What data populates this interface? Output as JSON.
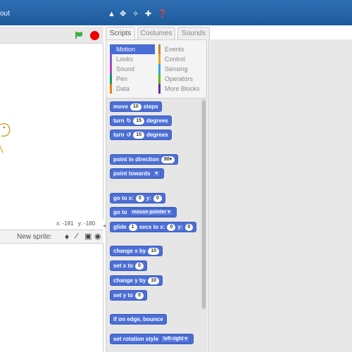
{
  "app": {
    "title_fragment": "out"
  },
  "toolbar": {
    "tools": [
      "stamp-icon",
      "grow-icon",
      "shrink-icon",
      "fullscreen-icon",
      "help-icon"
    ]
  },
  "stage": {
    "coords_x_label": "x:",
    "coords_x": "-181",
    "coords_y_label": "y:",
    "coords_y": "-180",
    "new_sprite_label": "New sprite:"
  },
  "tabs": {
    "scripts": "Scripts",
    "costumes": "Costumes",
    "sounds": "Sounds"
  },
  "categories": {
    "left": [
      {
        "label": "Motion",
        "color": "#4a6cd4"
      },
      {
        "label": "Looks",
        "color": "#8a55d7"
      },
      {
        "label": "Sound",
        "color": "#bb42c3"
      },
      {
        "label": "Pen",
        "color": "#0e9a6c"
      },
      {
        "label": "Data",
        "color": "#ee7d16"
      }
    ],
    "right": [
      {
        "label": "Events",
        "color": "#c88330"
      },
      {
        "label": "Control",
        "color": "#e1a91a"
      },
      {
        "label": "Sensing",
        "color": "#2ca5e2"
      },
      {
        "label": "Operators",
        "color": "#5cb712"
      },
      {
        "label": "More Blocks",
        "color": "#632d99"
      }
    ]
  },
  "blocks": {
    "move": {
      "a": "move",
      "v": "10",
      "b": "steps"
    },
    "turn_cw": {
      "a": "turn",
      "v": "15",
      "b": "degrees"
    },
    "turn_ccw": {
      "a": "turn",
      "v": "15",
      "b": "degrees"
    },
    "point_dir": {
      "a": "point in direction",
      "v": "90▾"
    },
    "point_towards": {
      "a": "point towards",
      "v": "▾"
    },
    "goto_xy": {
      "a": "go to x:",
      "v1": "0",
      "b": "y:",
      "v2": "0"
    },
    "goto": {
      "a": "go to",
      "v": "mouse-pointer ▾"
    },
    "glide": {
      "a": "glide",
      "v1": "1",
      "b": "secs to x:",
      "v2": "0",
      "c": "y:",
      "v3": "0"
    },
    "change_x": {
      "a": "change x by",
      "v": "10"
    },
    "set_x": {
      "a": "set x to",
      "v": "0"
    },
    "change_y": {
      "a": "change y by",
      "v": "10"
    },
    "set_y": {
      "a": "set y to",
      "v": "0"
    },
    "bounce": {
      "a": "if on edge, bounce"
    },
    "rotation": {
      "a": "set rotation style",
      "v": "left-right ▾"
    }
  }
}
